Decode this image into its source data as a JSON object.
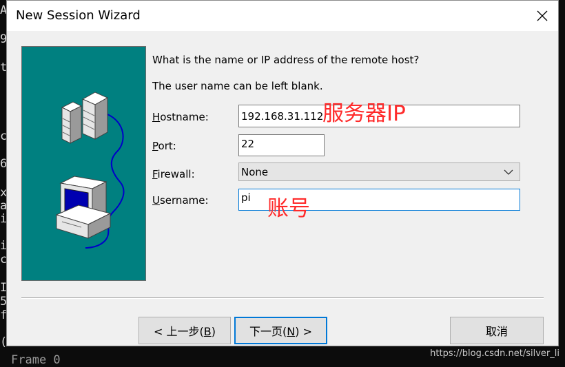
{
  "background_terminal": {
    "left_chars": [
      "A",
      "9",
      "t",
      "c",
      "6",
      "x",
      "a",
      "i",
      "i",
      "c",
      "I",
      "5",
      "f",
      "("
    ],
    "bottom_text": "Frame 0"
  },
  "dialog": {
    "title": "New Session Wizard",
    "close_glyph": "✕",
    "prompt": "What is the name or IP address of the remote host?",
    "note": "The user name can be left blank.",
    "fields": {
      "hostname": {
        "label_mnemonic": "H",
        "label_rest": "ostname:",
        "value": "192.168.31.112"
      },
      "port": {
        "label_mnemonic": "P",
        "label_rest": "ort:",
        "value": "22"
      },
      "firewall": {
        "label_mnemonic": "F",
        "label_rest": "irewall:",
        "value": "None"
      },
      "username": {
        "label_mnemonic": "U",
        "label_rest": "sername:",
        "value": "pi"
      }
    },
    "annotations": {
      "server_ip": "服务器IP",
      "account": "账号"
    },
    "buttons": {
      "back": {
        "prefix": "< 上一步(",
        "mnemonic": "B",
        "suffix": ")"
      },
      "next": {
        "prefix": "下一页(",
        "mnemonic": "N",
        "suffix": ") >"
      },
      "cancel": "取消"
    }
  },
  "watermark": "https://blog.csdn.net/silver_li",
  "colors": {
    "illustration_bg": "#008080",
    "focus_border": "#0078d7",
    "annotation": "#ff2a2a"
  }
}
